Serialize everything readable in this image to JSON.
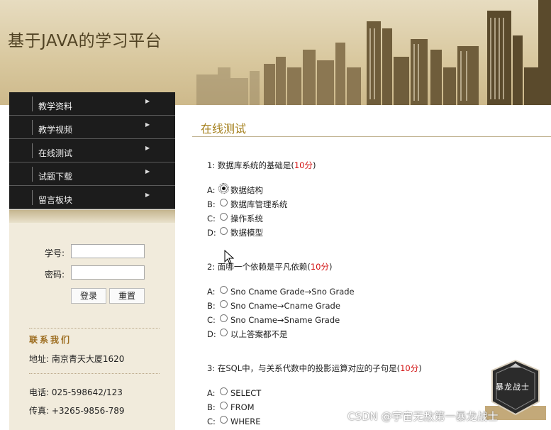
{
  "site_title": "基于JAVA的学习平台",
  "nav": [
    {
      "label": "教学资料"
    },
    {
      "label": "教学视频"
    },
    {
      "label": "在线测试"
    },
    {
      "label": "试题下载"
    },
    {
      "label": "留言板块"
    }
  ],
  "login": {
    "id_label": "学号:",
    "pwd_label": "密码:",
    "id_value": "",
    "pwd_value": "",
    "login_button": "登录",
    "reset_button": "重置"
  },
  "contact": {
    "title": "联系我们",
    "address": "地址: 南京青天大厦1620",
    "phone": "电话: 025-598642/123",
    "fax": "传真: +3265-9856-789"
  },
  "section_title": "在线测试",
  "questions": [
    {
      "prefix": "1: 数据库系统的基础是(",
      "score": "10分",
      "suffix": ")",
      "options": [
        {
          "letter": "A:",
          "text": "数据结构",
          "selected": true
        },
        {
          "letter": "B:",
          "text": "数据库管理系统",
          "selected": false
        },
        {
          "letter": "C:",
          "text": "操作系统",
          "selected": false
        },
        {
          "letter": "D:",
          "text": "数据模型",
          "selected": false
        }
      ]
    },
    {
      "prefix": "2: 面哪一个依赖是平凡依赖(",
      "score": "10分",
      "suffix": ")",
      "options": [
        {
          "letter": "A:",
          "text": "Sno Cname Grade→Sno Grade",
          "selected": false
        },
        {
          "letter": "B:",
          "text": "Sno Cname→Cname Grade",
          "selected": false
        },
        {
          "letter": "C:",
          "text": "Sno Cname→Sname Grade",
          "selected": false
        },
        {
          "letter": "D:",
          "text": "以上答案都不是",
          "selected": false
        }
      ]
    },
    {
      "prefix": "3: 在SQL中，与关系代数中的投影运算对应的子句是(",
      "score": "10分",
      "suffix": ")",
      "options": [
        {
          "letter": "A:",
          "text": "SELECT",
          "selected": false
        },
        {
          "letter": "B:",
          "text": "FROM",
          "selected": false
        },
        {
          "letter": "C:",
          "text": "WHERE",
          "selected": false
        }
      ]
    }
  ],
  "watermark": "CSDN @宇宙无敌第一暴龙战士",
  "badge_text": "暴龙战士",
  "colors": {
    "header_bg": "#d8c79d",
    "nav_bg": "#1c1c1c",
    "accent": "#a5801d",
    "score_red": "#d21010"
  }
}
